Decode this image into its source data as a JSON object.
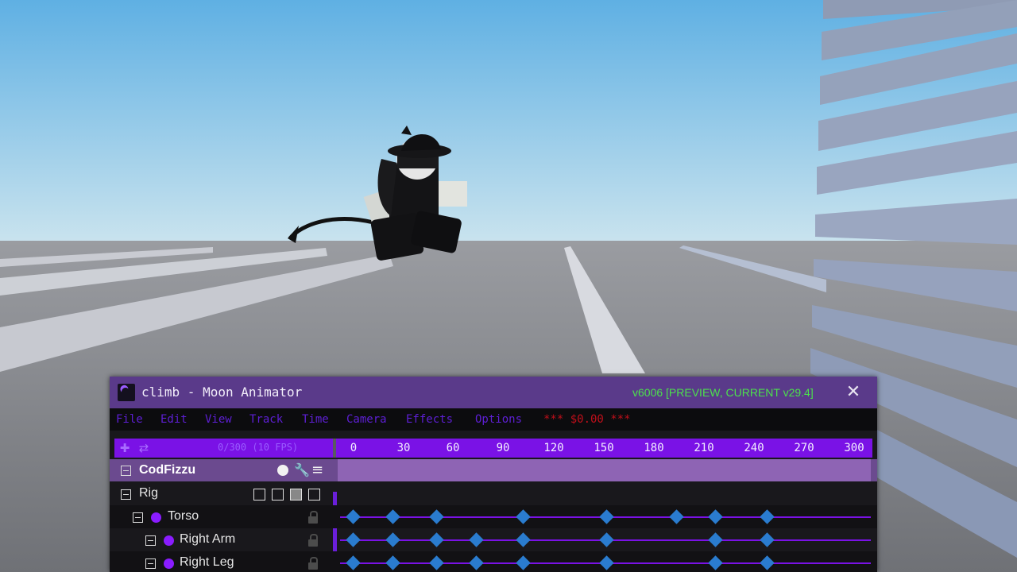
{
  "window": {
    "title": "climb - Moon Animator",
    "version": "v6006 [PREVIEW, CURRENT v29.4]",
    "close_icon": "close-icon"
  },
  "menu": {
    "items": [
      "File",
      "Edit",
      "View",
      "Track",
      "Time",
      "Camera",
      "Effects",
      "Options"
    ],
    "cost": "*** $0.00 ***"
  },
  "toolbar": {
    "frame_label": "0/300 (10 FPS)"
  },
  "ruler": {
    "ticks": [
      "0",
      "30",
      "60",
      "90",
      "120",
      "150",
      "180",
      "210",
      "240",
      "270",
      "300"
    ]
  },
  "tracks": {
    "model": "CodFizzu",
    "rig": "Rig",
    "parts": [
      {
        "label": "Torso",
        "keyframes": [
          0,
          24,
          50,
          102,
          152,
          194,
          217,
          248
        ]
      },
      {
        "label": "Right Arm",
        "keyframes": [
          0,
          24,
          50,
          74,
          102,
          152,
          217,
          248
        ]
      },
      {
        "label": "Right Leg",
        "keyframes": [
          0,
          24,
          50,
          74,
          102,
          152,
          217,
          248
        ]
      }
    ]
  },
  "colors": {
    "titlebar": "#5a3a8a",
    "accent": "#7a12e6",
    "keyframe": "#2a7ccf",
    "version": "#4ce04c"
  }
}
